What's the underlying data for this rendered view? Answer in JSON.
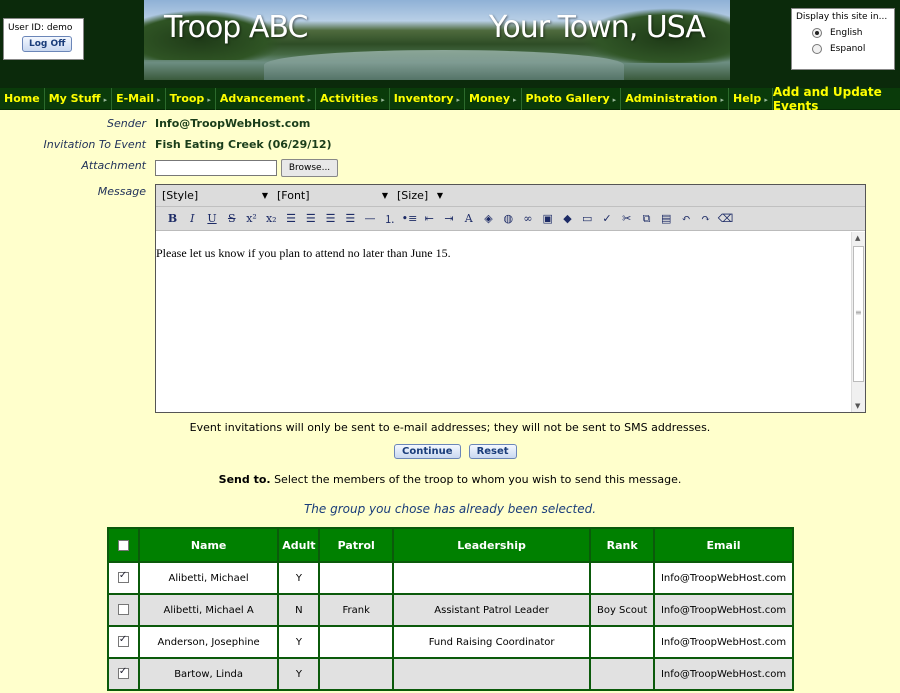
{
  "header": {
    "user_id": "User ID: demo",
    "logoff_label": "Log Off",
    "banner_left": "Troop ABC",
    "banner_right": "Your Town, USA",
    "lang_title": "Display this site in...",
    "lang_options": [
      "English",
      "Espanol"
    ],
    "lang_selected": "English"
  },
  "nav": {
    "items": [
      "Home",
      "My Stuff",
      "E-Mail",
      "Troop",
      "Advancement",
      "Activities",
      "Inventory",
      "Money",
      "Photo Gallery",
      "Administration",
      "Help"
    ],
    "page_title": "Add and Update Events"
  },
  "form": {
    "sender_label": "Sender",
    "sender_value": "Info@TroopWebHost.com",
    "event_label": "Invitation To Event",
    "event_value": "Fish Eating Creek (06/29/12)",
    "attachment_label": "Attachment",
    "attachment_value": "",
    "browse_label": "Browse...",
    "message_label": "Message",
    "style_select": "[Style]",
    "font_select": "[Font]",
    "size_select": "[Size]",
    "message_text": "Please let us know if you plan to attend no later than June 15.",
    "sms_note": "Event invitations will only be sent to e-mail addresses; they will not be sent to SMS addresses.",
    "continue_label": "Continue",
    "reset_label": "Reset",
    "send_to_bold": "Send to.",
    "send_to_text": " Select the members of the troop to whom you wish to send this message.",
    "group_msg": "The group you chose has already been selected."
  },
  "toolbar_icons": [
    "bold-icon",
    "italic-icon",
    "underline-icon",
    "strikethrough-icon",
    "superscript-icon",
    "subscript-icon",
    "align-left-icon",
    "align-center-icon",
    "align-right-icon",
    "justify-icon",
    "horizontal-rule-icon",
    "ordered-list-icon",
    "bullet-list-icon",
    "outdent-icon",
    "indent-icon",
    "font-color-icon",
    "highlight-icon",
    "globe-icon",
    "link-icon",
    "image-icon",
    "table-object-icon",
    "table-icon",
    "spellcheck-icon",
    "cut-icon",
    "copy-icon",
    "paste-icon",
    "undo-icon",
    "redo-icon",
    "clear-format-icon"
  ],
  "table": {
    "headers": [
      "Name",
      "Adult",
      "Patrol",
      "Leadership",
      "Rank",
      "Email"
    ],
    "rows": [
      {
        "checked": true,
        "name": "Alibetti, Michael",
        "adult": "Y",
        "patrol": "",
        "leadership": "",
        "rank": "",
        "email": "Info@TroopWebHost.com"
      },
      {
        "checked": false,
        "name": "Alibetti, Michael A",
        "adult": "N",
        "patrol": "Frank",
        "leadership": "Assistant Patrol Leader",
        "rank": "Boy Scout",
        "email": "Info@TroopWebHost.com"
      },
      {
        "checked": true,
        "name": "Anderson, Josephine",
        "adult": "Y",
        "patrol": "",
        "leadership": "Fund Raising Coordinator",
        "rank": "",
        "email": "Info@TroopWebHost.com"
      },
      {
        "checked": true,
        "name": "Bartow, Linda",
        "adult": "Y",
        "patrol": "",
        "leadership": "",
        "rank": "",
        "email": "Info@TroopWebHost.com"
      }
    ]
  }
}
